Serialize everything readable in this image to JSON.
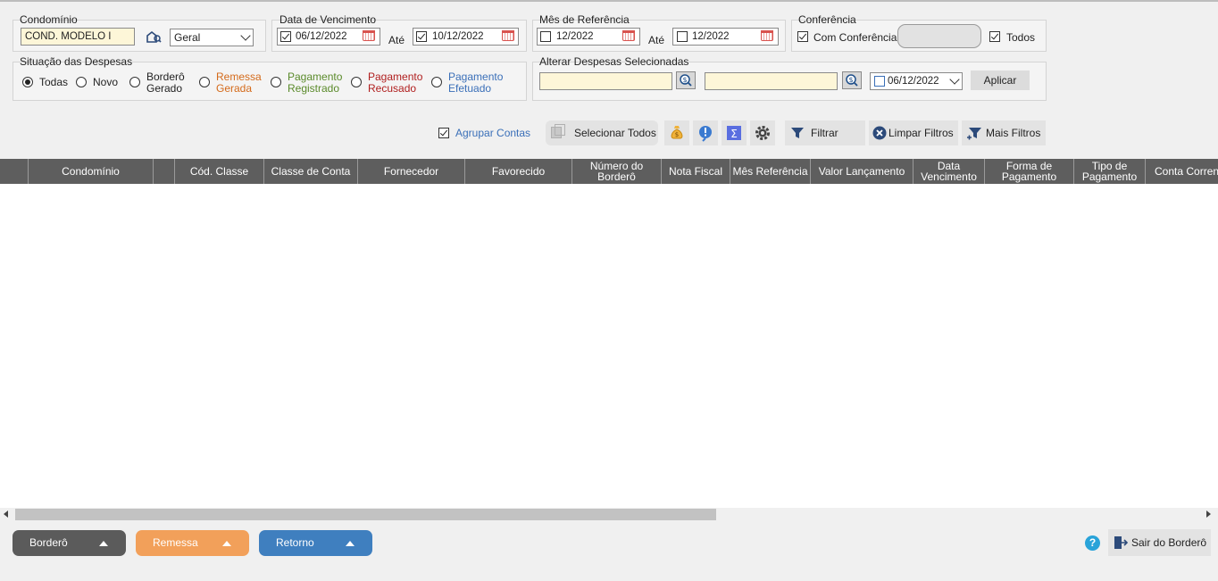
{
  "filters": {
    "condominio": {
      "label": "Condomínio",
      "value": "COND. MODELO I",
      "type_value": "Geral"
    },
    "vencimento": {
      "label": "Data de Vencimento",
      "from": "06/12/2022",
      "to": "10/12/2022",
      "ate": "Até"
    },
    "referencia": {
      "label": "Mês de Referência",
      "from": "12/2022",
      "to": "12/2022",
      "ate": "Até"
    },
    "conferencia": {
      "label": "Conferência",
      "com_label": "Com Conferência",
      "todos_label": "Todos"
    },
    "situacao": {
      "label": "Situação das Despesas",
      "options": [
        {
          "l1": "Todas",
          "l2": "",
          "color": "#222222"
        },
        {
          "l1": "Novo",
          "l2": "",
          "color": "#222222"
        },
        {
          "l1": "Borderô",
          "l2": "Gerado",
          "color": "#222222"
        },
        {
          "l1": "Remessa",
          "l2": "Gerada",
          "color": "#d46a1a"
        },
        {
          "l1": "Pagamento",
          "l2": "Registrado",
          "color": "#5a8a2a"
        },
        {
          "l1": "Pagamento",
          "l2": "Recusado",
          "color": "#b01e1e"
        },
        {
          "l1": "Pagamento",
          "l2": "Efetuado",
          "color": "#3a6fb8"
        }
      ]
    },
    "alterar": {
      "label": "Alterar Despesas Selecionadas",
      "date": "06/12/2022",
      "apply": "Aplicar"
    }
  },
  "toolbar": {
    "agrupar": "Agrupar Contas",
    "selecionar": "Selecionar Todos",
    "filtrar": "Filtrar",
    "limpar": "Limpar Filtros",
    "mais": "Mais Filtros"
  },
  "grid": {
    "columns": [
      "Condomínio",
      "Cód. Classe",
      "Classe de Conta",
      "Fornecedor",
      "Favorecido",
      "Número do Borderô",
      "Nota Fiscal",
      "Mês Referência",
      "Valor Lançamento",
      "Data Vencimento",
      "Forma de Pagamento",
      "Tipo de Pagamento",
      "Conta Corrente"
    ]
  },
  "bottom": {
    "bordero": "Borderô",
    "remessa": "Remessa",
    "retorno": "Retorno",
    "sair": "Sair do Borderô"
  },
  "colors": {
    "bordero": "#5b5b5b",
    "remessa": "#f2a05a",
    "retorno": "#3f7fbf",
    "header": "#5e5e5e"
  }
}
